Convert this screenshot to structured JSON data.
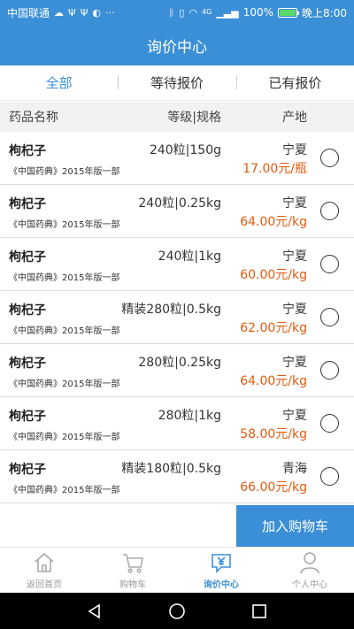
{
  "status_bar": {
    "carrier": "中国联通",
    "network": "4G",
    "battery": "100%",
    "battery_level": 1.0,
    "time": "晚上8:00"
  },
  "header": {
    "title": "询价中心"
  },
  "tabs": [
    {
      "label": "全部",
      "active": true
    },
    {
      "label": "等待报价",
      "active": false
    },
    {
      "label": "已有报价",
      "active": false
    }
  ],
  "columns": {
    "name": "药品名称",
    "spec": "等级|规格",
    "origin": "产地"
  },
  "items": [
    {
      "name": "枸杞子",
      "standard": "《中国药典》2015年版一部",
      "spec": "240粒|150g",
      "origin": "宁夏",
      "price": "17.00元/瓶"
    },
    {
      "name": "枸杞子",
      "standard": "《中国药典》2015年版一部",
      "spec": "240粒|0.25kg",
      "origin": "宁夏",
      "price": "64.00元/kg"
    },
    {
      "name": "枸杞子",
      "standard": "《中国药典》2015年版一部",
      "spec": "240粒|1kg",
      "origin": "宁夏",
      "price": "60.00元/kg"
    },
    {
      "name": "枸杞子",
      "standard": "《中国药典》2015年版一部",
      "spec": "精装280粒|0.5kg",
      "origin": "宁夏",
      "price": "62.00元/kg"
    },
    {
      "name": "枸杞子",
      "standard": "《中国药典》2015年版一部",
      "spec": "280粒|0.25kg",
      "origin": "宁夏",
      "price": "64.00元/kg"
    },
    {
      "name": "枸杞子",
      "standard": "《中国药典》2015年版一部",
      "spec": "280粒|1kg",
      "origin": "宁夏",
      "price": "58.00元/kg"
    },
    {
      "name": "枸杞子",
      "standard": "《中国药典》2015年版一部",
      "spec": "精装180粒|0.5kg",
      "origin": "青海",
      "price": "66.00元/kg"
    }
  ],
  "cart_button": {
    "label": "加入购物车"
  },
  "bottom_nav": [
    {
      "label": "返回首页",
      "icon": "home-icon",
      "active": false
    },
    {
      "label": "购物车",
      "icon": "cart-icon",
      "active": false
    },
    {
      "label": "询价中心",
      "icon": "inquiry-icon",
      "active": true
    },
    {
      "label": "个人中心",
      "icon": "user-icon",
      "active": false
    }
  ],
  "colors": {
    "primary": "#3b8fd6",
    "price": "#e05a10",
    "header_bg": "#f2f2f2"
  }
}
